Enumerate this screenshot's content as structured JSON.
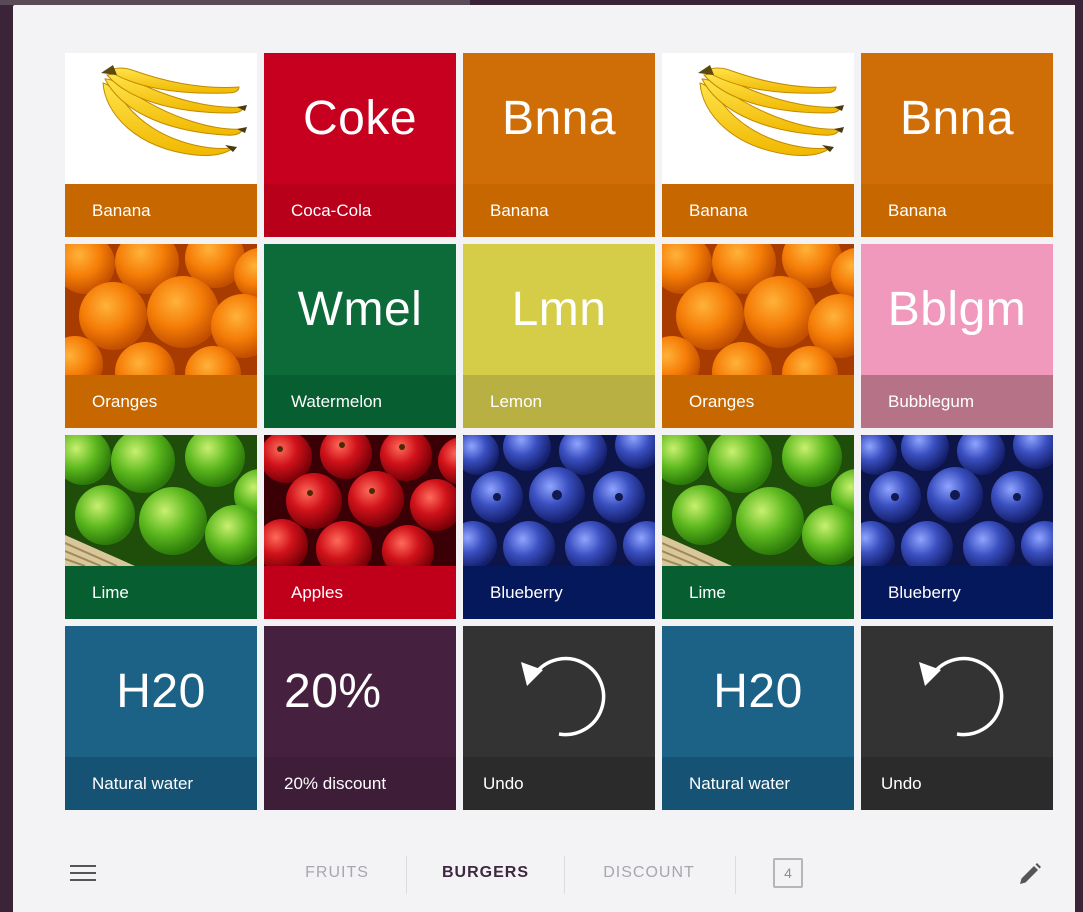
{
  "colors": {
    "orange": "#cf6d06",
    "orange_label": "#c66700",
    "coke_red": "#c8001f",
    "coke_label": "#b9001b",
    "green": "#0d6b3a",
    "green_label": "#065e31",
    "lemon": "#d5cc47",
    "lemon_label": "#b8b043",
    "pink": "#f198bd",
    "pink_label": "#b67388",
    "apples_label": "#c0001a",
    "navy_label": "#06185c",
    "teal": "#1b6286",
    "teal_label": "#155274",
    "plum": "#46213f",
    "plum_label": "#3e1d38",
    "dark": "#333333",
    "dark_label": "#2b2b2b"
  },
  "tiles": {
    "t11": {
      "label": "Banana",
      "image": "banana"
    },
    "t12": {
      "abbr": "Coke",
      "label": "Coca-Cola"
    },
    "t13": {
      "abbr": "Bnna",
      "label": "Banana"
    },
    "t14": {
      "label": "Banana",
      "image": "banana"
    },
    "t15": {
      "abbr": "Bnna",
      "label": "Banana"
    },
    "t21": {
      "label": "Oranges",
      "image": "oranges"
    },
    "t22": {
      "abbr": "Wmel",
      "label": "Watermelon"
    },
    "t23": {
      "abbr": "Lmn",
      "label": "Lemon"
    },
    "t24": {
      "label": "Oranges",
      "image": "oranges"
    },
    "t25": {
      "abbr": "Bblgm",
      "label": "Bubblegum"
    },
    "t31": {
      "label": "Lime",
      "image": "limes"
    },
    "t32": {
      "label": "Apples",
      "image": "apples"
    },
    "t33": {
      "label": "Blueberry",
      "image": "blueberries"
    },
    "t34": {
      "label": "Lime",
      "image": "limes"
    },
    "t35": {
      "label": "Blueberry",
      "image": "blueberries"
    },
    "t41": {
      "abbr": "H20",
      "label": "Natural water"
    },
    "t42": {
      "abbr": "20%",
      "label": "20% discount"
    },
    "t43": {
      "label": "Undo",
      "icon": "undo-icon"
    },
    "t44": {
      "abbr": "H20",
      "label": "Natural water"
    },
    "t45": {
      "label": "Undo",
      "icon": "undo-icon"
    }
  },
  "bottom_bar": {
    "menu_icon": "hamburger-menu-icon",
    "tabs": [
      {
        "label": "FRUITS",
        "active": false
      },
      {
        "label": "BURGERS",
        "active": true
      },
      {
        "label": "DISCOUNT",
        "active": false
      }
    ],
    "count": "4",
    "edit_icon": "pencil-icon"
  }
}
